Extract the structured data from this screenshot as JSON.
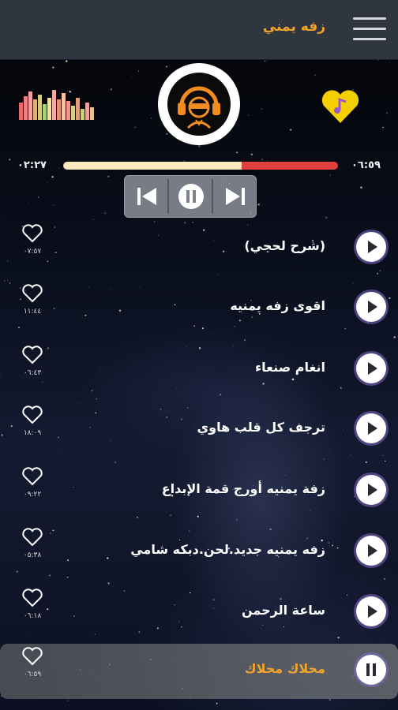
{
  "header": {
    "title": "زفه يمني",
    "menu_icon": "hamburger-menu-icon"
  },
  "player": {
    "elapsed": "٠٢:٢٧",
    "total": "٠٦:٥٩",
    "progress": 0.65,
    "colors": {
      "played": "#fbe9bd",
      "remaining": "#e04040",
      "accent": "#f0a52a"
    }
  },
  "tracks": [
    {
      "title": "(شرح لحجي)",
      "duration": "٠٧:٥٧",
      "state": "play"
    },
    {
      "title": "اقوى زفه يمنيه",
      "duration": "١١:٤٤",
      "state": "play"
    },
    {
      "title": "انغام صنعاء",
      "duration": "٠٦:٤٣",
      "state": "play"
    },
    {
      "title": "ترجف كل قلب هاوي",
      "duration": "١٨:٠٩",
      "state": "play"
    },
    {
      "title": "زفة يمنيه أورج قمة الإبداع",
      "duration": "٠٩:٢٢",
      "state": "play"
    },
    {
      "title": "زفه يمنيه جديد.لحن.دبكه شامي",
      "duration": "٠٥:٣٨",
      "state": "play"
    },
    {
      "title": "ساعة الرحمن",
      "duration": "٠٦:١٨",
      "state": "play"
    },
    {
      "title": "محلاك محلاك",
      "duration": "٠٦:٥٩",
      "state": "pause"
    }
  ]
}
